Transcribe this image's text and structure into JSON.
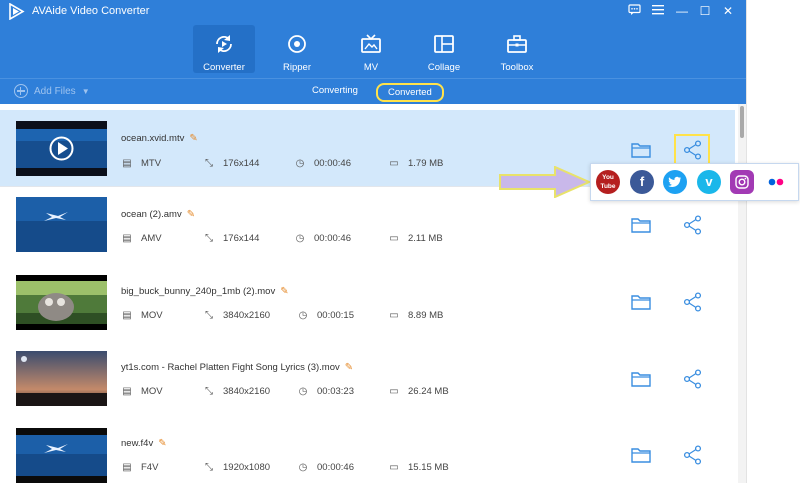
{
  "app": {
    "title": "AVAide Video Converter"
  },
  "window_controls": {
    "feedback": "feedback-icon",
    "menu": "menu-icon",
    "minimize": "—",
    "maximize": "☐",
    "close": "✕"
  },
  "nav": {
    "tabs": [
      {
        "label": "Converter",
        "icon": "converter-icon",
        "active": true
      },
      {
        "label": "Ripper",
        "icon": "ripper-icon"
      },
      {
        "label": "MV",
        "icon": "mv-icon"
      },
      {
        "label": "Collage",
        "icon": "collage-icon"
      },
      {
        "label": "Toolbox",
        "icon": "toolbox-icon"
      }
    ]
  },
  "toolbar": {
    "add_files": "Add Files",
    "converting": "Converting",
    "converted": "Converted"
  },
  "files": [
    {
      "name": "ocean.xvid.mtv",
      "format": "MTV",
      "resolution": "176x144",
      "duration": "00:00:46",
      "size": "1.79 MB",
      "selected": true
    },
    {
      "name": "ocean (2).amv",
      "format": "AMV",
      "resolution": "176x144",
      "duration": "00:00:46",
      "size": "2.11 MB"
    },
    {
      "name": "big_buck_bunny_240p_1mb (2).mov",
      "format": "MOV",
      "resolution": "3840x2160",
      "duration": "00:00:15",
      "size": "8.89 MB"
    },
    {
      "name": "yt1s.com - Rachel Platten  Fight Song Lyrics (3).mov",
      "format": "MOV",
      "resolution": "3840x2160",
      "duration": "00:03:23",
      "size": "26.24 MB"
    },
    {
      "name": "new.f4v",
      "format": "F4V",
      "resolution": "1920x1080",
      "duration": "00:00:46",
      "size": "15.15 MB"
    }
  ],
  "share_menu": {
    "youtube_label": "You Tube",
    "items": [
      "youtube-icon",
      "facebook-icon",
      "twitter-icon",
      "vimeo-icon",
      "instagram-icon",
      "flickr-icon"
    ],
    "facebook_glyph": "f",
    "vimeo_glyph": "v"
  },
  "colors": {
    "header": "#2f7fd9",
    "selected_row": "#d3e8fb",
    "highlight": "#ffe24a",
    "arrow": "#c9b8ea"
  }
}
